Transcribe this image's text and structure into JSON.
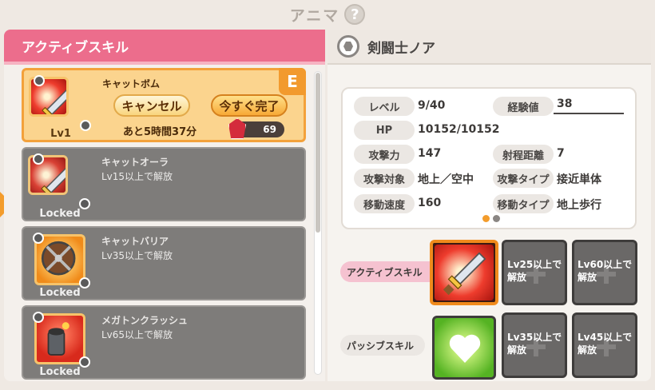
{
  "header": {
    "title": "アニマ",
    "help_label": "?"
  },
  "left_panel": {
    "title": "アクティブスキル",
    "cards": [
      {
        "name": "キャットボム",
        "level": "Lv1",
        "badge": "E",
        "cancel_label": "キャンセル",
        "complete_label": "今すぐ完了",
        "remaining": "あと5時間37分",
        "gem_count": "69",
        "icon": "sword-icon",
        "state": "active"
      },
      {
        "name": "キャットオーラ",
        "unlock": "Lv15以上で解放",
        "status": "Locked",
        "icon": "sword-icon",
        "state": "locked"
      },
      {
        "name": "キャットバリア",
        "unlock": "Lv35以上で解放",
        "status": "Locked",
        "icon": "shield-icon",
        "state": "locked"
      },
      {
        "name": "メガトンクラッシュ",
        "unlock": "Lv65以上で解放",
        "status": "Locked",
        "icon": "cannon-icon",
        "state": "locked"
      }
    ]
  },
  "right_panel": {
    "name": "剣闘士ノア",
    "stats": [
      {
        "label": "レベル",
        "value": "9/40"
      },
      {
        "label": "経験値",
        "value": "38"
      },
      {
        "label": "HP",
        "value": "10152/10152"
      },
      {
        "label": "攻撃力",
        "value": "147"
      },
      {
        "label": "射程距離",
        "value": "7"
      },
      {
        "label": "攻撃対象",
        "value": "地上／空中"
      },
      {
        "label": "攻撃タイプ",
        "value": "接近単体"
      },
      {
        "label": "移動速度",
        "value": "160"
      },
      {
        "label": "移動タイプ",
        "value": "地上歩行"
      }
    ],
    "active_label": "アクティブスキル",
    "passive_label": "パッシブスキル",
    "active_slots": [
      "Lv25以上で\n解放",
      "Lv60以上で\n解放"
    ],
    "passive_slots": [
      "Lv35以上で\n解放",
      "Lv45以上で\n解放"
    ]
  },
  "colors": {
    "accent_pink": "#ec6d8c",
    "accent_orange": "#f39c2c",
    "page_dot_active": "#f39c2c",
    "page_dot_inactive": "#8a8683"
  }
}
